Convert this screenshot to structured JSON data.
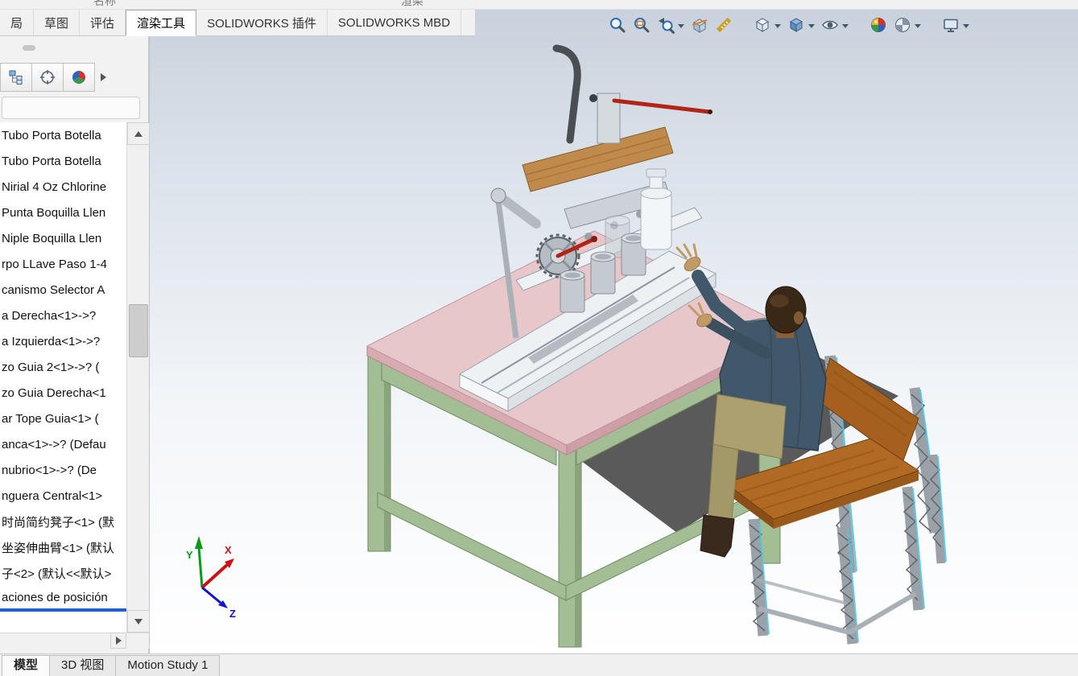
{
  "colors": {
    "accent_blue": "#1f5fd0",
    "table_top": "#e8c7cb",
    "table_edge": "#d5a9af",
    "frame_green": "#a3bd95",
    "frame_green_dark": "#6f8c63",
    "floor_shadow": "#4e4e4e",
    "machine_white": "#eef1f4",
    "wood": "#c08a4a",
    "chair_wood": "#b06a24",
    "metal_gray": "#9aa2a8",
    "chair_accent": "#49c8e8",
    "shirt": "#41586a",
    "skin": "#c29a66",
    "pants": "#ada070",
    "axis_x": "#cc1111",
    "axis_y": "#0a9a1a",
    "axis_z": "#1414cc"
  },
  "top_clipped_labels": [
    "名称",
    "渲染"
  ],
  "ribbon": {
    "tabs": [
      {
        "label": "局",
        "active": false
      },
      {
        "label": "草图",
        "active": false
      },
      {
        "label": "评估",
        "active": false
      },
      {
        "label": "渲染工具",
        "active": true
      },
      {
        "label": "SOLIDWORKS 插件",
        "active": false
      },
      {
        "label": "SOLIDWORKS MBD",
        "active": false
      }
    ]
  },
  "hud_toolbar": {
    "icons": [
      "zoom-to-fit",
      "zoom-to-area",
      "previous-view",
      "section-view",
      "measure",
      "view-orientation",
      "display-style",
      "hide-show-items",
      "edit-appearance",
      "apply-scene",
      "view-settings"
    ]
  },
  "feature_panel": {
    "tree_items": [
      "Tubo Porta Botella",
      "Tubo Porta Botella",
      "Nirial 4 Oz Chlorine",
      "Punta Boquilla Llen",
      "Niple Boquilla Llen",
      "rpo LLave Paso 1-4",
      "canismo Selector A",
      "a Derecha<1>->?",
      "a Izquierda<1>->?",
      "zo Guia 2<1>->? (",
      "zo Guia Derecha<1",
      "ar Tope Guia<1> (",
      "anca<1>->? (Defau",
      "nubrio<1>->? (De",
      "nguera Central<1>",
      "时尚简约凳子<1> (默",
      "坐姿伸曲臂<1> (默认",
      "子<2> (默认<<默认>",
      "aciones de posición"
    ],
    "selected_item": "aciones de posición"
  },
  "status_bar": {
    "tabs": [
      {
        "label": "模型",
        "active": true
      },
      {
        "label": "3D 视图",
        "active": false
      },
      {
        "label": "Motion Study 1",
        "active": false
      }
    ]
  },
  "triad": {
    "x_label": "X",
    "y_label": "Y",
    "z_label": "Z"
  }
}
